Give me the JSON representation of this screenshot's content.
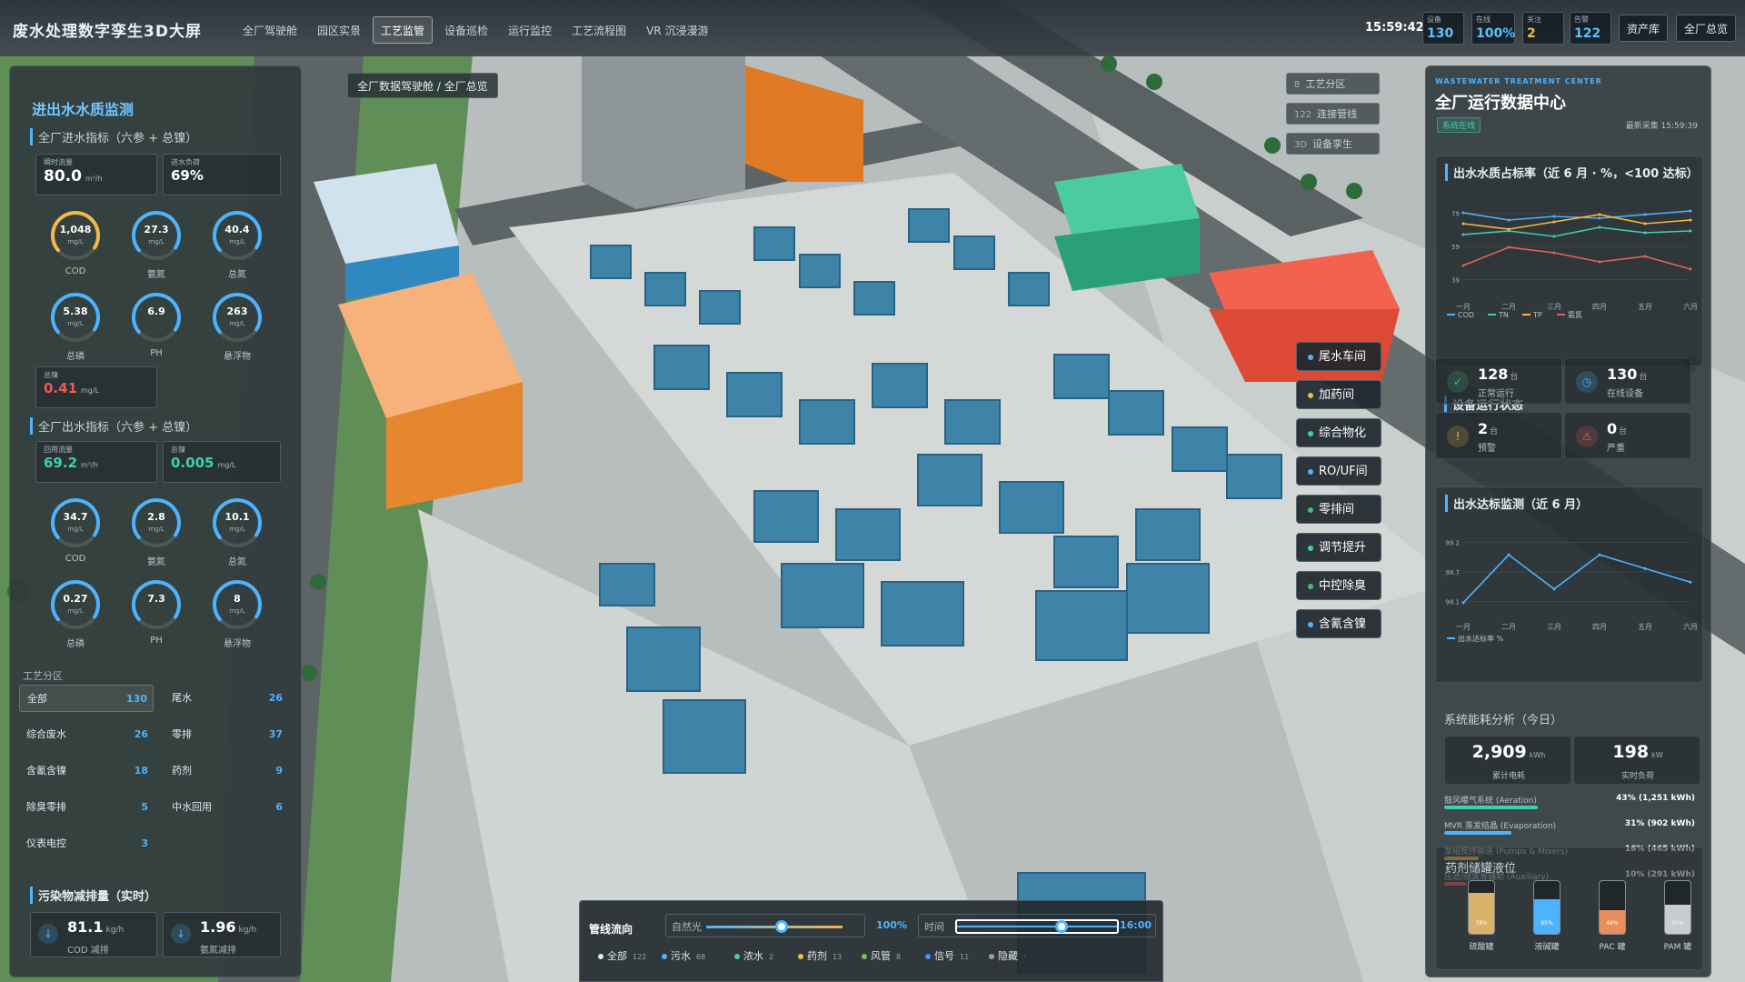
{
  "app": {
    "title": "废水处理数字孪生3D大屏"
  },
  "nav": {
    "tabs": [
      "全厂驾驶舱",
      "园区实景",
      "工艺监管",
      "设备巡检",
      "运行监控",
      "工艺流程图",
      "VR 沉浸漫游"
    ],
    "active_index": 2
  },
  "header": {
    "clock": "15:59:42",
    "stats": [
      {
        "label": "设备",
        "value": "130",
        "color": "#5cc0ff"
      },
      {
        "label": "在线",
        "value": "100%",
        "color": "#5cc0ff"
      },
      {
        "label": "关注",
        "value": "2",
        "color": "#f2b84b"
      },
      {
        "label": "告警",
        "value": "122",
        "color": "#5cc0ff"
      }
    ],
    "buttons": [
      "资产库",
      "全厂总览"
    ]
  },
  "breadcrumb": "全厂数据驾驶舱 / 全厂总览",
  "scene_buttons": [
    {
      "num": "8",
      "label": "工艺分区"
    },
    {
      "num": "122",
      "label": "连接管线"
    },
    {
      "num": "3D",
      "label": "设备孪生"
    }
  ],
  "left": {
    "section_title": "进出水水质监测",
    "inlet": {
      "title": "全厂进水指标（六参 + 总镍）",
      "flow": {
        "label": "瞬时流量",
        "value": "80.0",
        "unit": "m³/h"
      },
      "load": {
        "label": "进水负荷",
        "value": "69%"
      },
      "gauges": [
        {
          "value": "1,048",
          "unit": "mg/L",
          "label": "COD",
          "color": "#f2b84b",
          "frac": 0.7
        },
        {
          "value": "27.3",
          "unit": "mg/L",
          "label": "氨氮",
          "color": "#4db3ff",
          "frac": 0.7
        },
        {
          "value": "40.4",
          "unit": "mg/L",
          "label": "总氮",
          "color": "#4db3ff",
          "frac": 0.7
        },
        {
          "value": "5.38",
          "unit": "mg/L",
          "label": "总磷",
          "color": "#4db3ff",
          "frac": 0.7
        },
        {
          "value": "6.9",
          "unit": "",
          "label": "PH",
          "color": "#4db3ff",
          "frac": 0.7
        },
        {
          "value": "263",
          "unit": "mg/L",
          "label": "悬浮物",
          "color": "#4db3ff",
          "frac": 0.7
        }
      ],
      "nickel": {
        "label": "总镍",
        "value": "0.41",
        "unit": "mg/L"
      }
    },
    "outlet": {
      "title": "全厂出水指标（六参 + 总镍）",
      "flow": {
        "label": "回用流量",
        "value": "69.2",
        "unit": "m³/h"
      },
      "nickel": {
        "label": "总镍",
        "value": "0.005",
        "unit": "mg/L"
      },
      "gauges": [
        {
          "value": "34.7",
          "unit": "mg/L",
          "label": "COD",
          "color": "#4db3ff",
          "frac": 0.7
        },
        {
          "value": "2.8",
          "unit": "mg/L",
          "label": "氨氮",
          "color": "#4db3ff",
          "frac": 0.7
        },
        {
          "value": "10.1",
          "unit": "mg/L",
          "label": "总氮",
          "color": "#4db3ff",
          "frac": 0.7
        },
        {
          "value": "0.27",
          "unit": "mg/L",
          "label": "总磷",
          "color": "#4db3ff",
          "frac": 0.7
        },
        {
          "value": "7.3",
          "unit": "",
          "label": "PH",
          "color": "#4db3ff",
          "frac": 0.7
        },
        {
          "value": "8",
          "unit": "mg/L",
          "label": "悬浮物",
          "color": "#4db3ff",
          "frac": 0.7
        }
      ]
    },
    "zones_title": "工艺分区",
    "zones": [
      {
        "name": "全部",
        "count": "130"
      },
      {
        "name": "尾水",
        "count": "26"
      },
      {
        "name": "综合废水",
        "count": "26"
      },
      {
        "name": "零排",
        "count": "37"
      },
      {
        "name": "含氰含镍",
        "count": "18"
      },
      {
        "name": "药剂",
        "count": "9"
      },
      {
        "name": "除臭零排",
        "count": "5"
      },
      {
        "name": "中水回用",
        "count": "6"
      },
      {
        "name": "仪表电控",
        "count": "3"
      }
    ],
    "reduction": {
      "title": "污染物减排量（实时）",
      "items": [
        {
          "value": "81.1",
          "unit": "kg/h",
          "label": "COD 减排"
        },
        {
          "value": "1.96",
          "unit": "kg/h",
          "label": "氨氮减排"
        }
      ]
    }
  },
  "right": {
    "center_en": "WASTEWATER TREATMENT CENTER",
    "center_title": "全厂运行数据中心",
    "status_badge": "系统在线",
    "latest": "最新采集 15:59:39",
    "quality_chart_title": "出水水质占标率（近 6 月 · %，<100 达标）",
    "compliance_chart_title": "出水达标监测（近 6 月）",
    "device_title": "设备运行状态",
    "devices": [
      {
        "icon": "✓",
        "value": "128",
        "unit": "台",
        "label": "正常运行",
        "color": "#3fbf7f"
      },
      {
        "icon": "◷",
        "value": "130",
        "unit": "台",
        "label": "在线设备",
        "color": "#4db3ff"
      },
      {
        "icon": "!",
        "value": "2",
        "unit": "台",
        "label": "预警",
        "color": "#f2b84b"
      },
      {
        "icon": "⚠",
        "value": "0",
        "unit": "台",
        "label": "严重",
        "color": "#e85a5a"
      }
    ],
    "energy": {
      "title": "系统能耗分析（今日）",
      "total": {
        "value": "2,909",
        "unit": "kWh",
        "label": "累计电耗"
      },
      "load": {
        "value": "198",
        "unit": "kW",
        "label": "实时负荷"
      },
      "rows": [
        {
          "label": "鼓风曝气系统 (Aeration)",
          "value": "43% (1,251 kWh)",
          "pct": 43,
          "color": "#3fcfb0"
        },
        {
          "label": "MVR 蒸发结晶 (Evaporation)",
          "value": "31% (902 kWh)",
          "pct": 31,
          "color": "#4db3ff"
        },
        {
          "label": "泵组搅拌输送 (Pumps & Mixers)",
          "value": "16% (465 kWh)",
          "pct": 16,
          "color": "#f2b84b"
        },
        {
          "label": "压滤/除臭等辅助 (Auxiliary)",
          "value": "10% (291 kWh)",
          "pct": 10,
          "color": "#e8605a"
        }
      ]
    },
    "tanks": {
      "title": "药剂储罐液位",
      "items": [
        {
          "label": "硫酸罐",
          "pct": "78%",
          "level": 0.78,
          "color": "#d9b26a"
        },
        {
          "label": "液碱罐",
          "pct": "65%",
          "level": 0.65,
          "color": "#4db3ff"
        },
        {
          "label": "PAC 罐",
          "pct": "44%",
          "level": 0.44,
          "color": "#e8905a"
        },
        {
          "label": "PAM 罐",
          "pct": "55%",
          "level": 0.55,
          "color": "#c8ccd0"
        }
      ]
    }
  },
  "chart_data": [
    {
      "type": "line",
      "title": "出水水质占标率（近 6 月 · %，<100 达标）",
      "categories": [
        "一月",
        "二月",
        "三月",
        "四月",
        "五月",
        "六月"
      ],
      "yticks": [
        "79",
        "59",
        "39"
      ],
      "ylim": [
        30,
        85
      ],
      "series": [
        {
          "name": "COD",
          "color": "#4db3ff",
          "values": [
            76,
            72,
            74,
            73,
            75,
            77
          ]
        },
        {
          "name": "TN",
          "color": "#3fcfb0",
          "values": [
            64,
            66,
            63,
            68,
            65,
            66
          ]
        },
        {
          "name": "TP",
          "color": "#f2b84b",
          "values": [
            70,
            67,
            71,
            75,
            70,
            72
          ]
        },
        {
          "name": "氨氮",
          "color": "#e8605a",
          "values": [
            47,
            57,
            54,
            49,
            52,
            45
          ]
        }
      ],
      "legend": "bottom"
    },
    {
      "type": "line",
      "title": "出水达标监测（近 6 月）",
      "categories": [
        "一月",
        "二月",
        "三月",
        "四月",
        "五月",
        "六月"
      ],
      "yticks": [
        "99.2",
        "98.7",
        "98.1"
      ],
      "ylim": [
        98.0,
        99.3
      ],
      "series": [
        {
          "name": "出水达标率 %",
          "color": "#4db3ff",
          "values": [
            98.2,
            98.9,
            98.4,
            98.9,
            98.7,
            98.5
          ]
        }
      ],
      "legend": "bottom"
    }
  ],
  "workshops": [
    {
      "name": "尾水车间",
      "color": "#4db3ff"
    },
    {
      "name": "加药间",
      "color": "#f2b84b"
    },
    {
      "name": "综合物化",
      "color": "#3fcfb0"
    },
    {
      "name": "RO/UF间",
      "color": "#4db3ff"
    },
    {
      "name": "零排间",
      "color": "#3fbf7f"
    },
    {
      "name": "调节提升",
      "color": "#3fcfb0"
    },
    {
      "name": "中控除臭",
      "color": "#3fbf7f"
    },
    {
      "name": "含氰含镍",
      "color": "#4db3ff"
    }
  ],
  "bottom": {
    "pipe_label": "管线流向",
    "light_label": "自然光",
    "light_value": "100%",
    "light_level": 0.55,
    "time_label": "时间",
    "time_value": "16:00",
    "time_level": 0.65,
    "legend": [
      {
        "name": "全部",
        "count": "122",
        "color": "#dfe8ee"
      },
      {
        "name": "污水",
        "count": "68",
        "color": "#4db3ff"
      },
      {
        "name": "浓水",
        "count": "2",
        "color": "#3fcfb0"
      },
      {
        "name": "药剂",
        "count": "13",
        "color": "#f2b84b"
      },
      {
        "name": "风管",
        "count": "8",
        "color": "#7ac05a"
      },
      {
        "name": "信号",
        "count": "11",
        "color": "#5a8aff"
      },
      {
        "name": "隐藏",
        "count": "·",
        "color": "#8fa2ad"
      }
    ]
  }
}
